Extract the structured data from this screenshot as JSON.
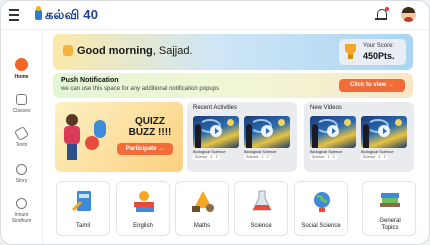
{
  "app": {
    "logo_text": "கல்வி 40"
  },
  "header": {
    "bell_icon": "bell-icon",
    "avatar_icon": "avatar-icon"
  },
  "sidebar": {
    "items": [
      {
        "label": "Home",
        "icon": "home-icon",
        "active": true
      },
      {
        "label": "Classes",
        "icon": "classes-icon",
        "active": false
      },
      {
        "label": "Tests",
        "icon": "tests-icon",
        "active": false
      },
      {
        "label": "Story",
        "icon": "story-icon",
        "active": false
      },
      {
        "label": "Innum Sindhum",
        "icon": "innum-sindhum-icon",
        "active": false
      }
    ]
  },
  "greeting": {
    "text": "Good morning",
    "name": ", Sajjad.",
    "score_label": "Your Score:",
    "score_value": "450Pts."
  },
  "notification": {
    "title": "Push Notification",
    "subtitle": "we can use this space for any additional notification popups",
    "button": "Click to view →"
  },
  "quiz": {
    "title_line1": "QUIZZ",
    "title_line2": "BUZZ !!!!",
    "button": "Participate →"
  },
  "recent_activities": {
    "title": "Recent Activities",
    "items": [
      {
        "subject": "Biological Science",
        "tag": "Science · 1 · 2"
      },
      {
        "subject": "Biological Science",
        "tag": "Science · 1 · 2"
      }
    ]
  },
  "new_videos": {
    "title": "New Videos",
    "items": [
      {
        "subject": "Biological Science",
        "tag": "Science · 1 · 2"
      },
      {
        "subject": "Biological Science",
        "tag": "Science · 1 · 2"
      }
    ]
  },
  "subjects": [
    {
      "label": "Tamil",
      "color": "#3d8bd9"
    },
    {
      "label": "English",
      "color": "#e84b3c"
    },
    {
      "label": "Maths",
      "color": "#f5a623"
    },
    {
      "label": "Science",
      "color": "#c9c9c9"
    },
    {
      "label": "Social Science",
      "color": "#6bbf59"
    },
    {
      "label": "General Topics",
      "color": "#8a6a4a"
    }
  ]
}
